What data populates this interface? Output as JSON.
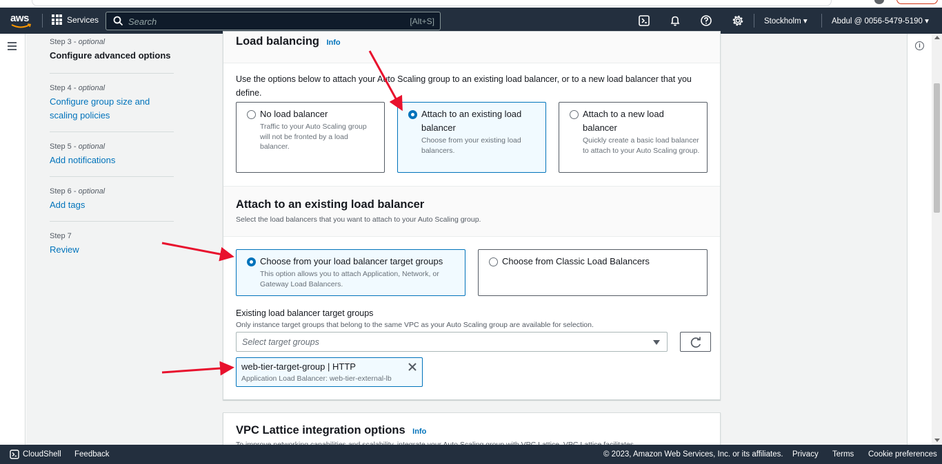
{
  "topbar": {
    "logo_text": "aws",
    "services_label": "Services",
    "search_placeholder": "Search",
    "search_shortcut": "[Alt+S]",
    "region": "Stockholm ▾",
    "account": "Abdul @ 0056-5479-5190 ▾"
  },
  "steps": [
    {
      "num": "Step 3",
      "optional": "optional",
      "name": "Configure advanced options",
      "state": "current"
    },
    {
      "num": "Step 4",
      "optional": "optional",
      "name": "Configure group size and scaling policies",
      "state": "link"
    },
    {
      "num": "Step 5",
      "optional": "optional",
      "name": "Add notifications",
      "state": "link"
    },
    {
      "num": "Step 6",
      "optional": "optional",
      "name": "Add tags",
      "state": "link"
    },
    {
      "num": "Step 7",
      "optional": "",
      "name": "Review",
      "state": "link"
    }
  ],
  "load_balancing": {
    "title": "Load balancing",
    "info": "Info",
    "description": "Use the options below to attach your Auto Scaling group to an existing load balancer, or to a new load balancer that you define.",
    "options": [
      {
        "title": "No load balancer",
        "desc": "Traffic to your Auto Scaling group will not be fronted by a load balancer.",
        "selected": false
      },
      {
        "title": "Attach to an existing load balancer",
        "desc": "Choose from your existing load balancers.",
        "selected": true
      },
      {
        "title": "Attach to a new load balancer",
        "desc": "Quickly create a basic load balancer to attach to your Auto Scaling group.",
        "selected": false
      }
    ]
  },
  "attach_existing": {
    "title": "Attach to an existing load balancer",
    "description": "Select the load balancers that you want to attach to your Auto Scaling group.",
    "options": [
      {
        "title": "Choose from your load balancer target groups",
        "desc": "This option allows you to attach Application, Network, or Gateway Load Balancers.",
        "selected": true
      },
      {
        "title": "Choose from Classic Load Balancers",
        "desc": "",
        "selected": false
      }
    ],
    "target_groups_label": "Existing load balancer target groups",
    "target_groups_hint": "Only instance target groups that belong to the same VPC as your Auto Scaling group are available for selection.",
    "select_placeholder": "Select target groups",
    "selected_token": {
      "name": "web-tier-target-group | HTTP",
      "detail": "Application Load Balancer: web-tier-external-lb"
    }
  },
  "vpc_lattice": {
    "title": "VPC Lattice integration options",
    "info": "Info",
    "description_partial": "To improve networking capabilities and scalability, integrate your Auto Scaling group with VPC Lattice. VPC Lattice facilitates"
  },
  "footer": {
    "cloudshell": "CloudShell",
    "feedback": "Feedback",
    "copyright": "© 2023, Amazon Web Services, Inc. or its affiliates.",
    "privacy": "Privacy",
    "terms": "Terms",
    "cookie": "Cookie preferences"
  },
  "colors": {
    "nav_bg": "#232f3e",
    "link": "#0073bb",
    "selected_bg": "#f1faff",
    "annotation_arrow": "#e8112d"
  }
}
